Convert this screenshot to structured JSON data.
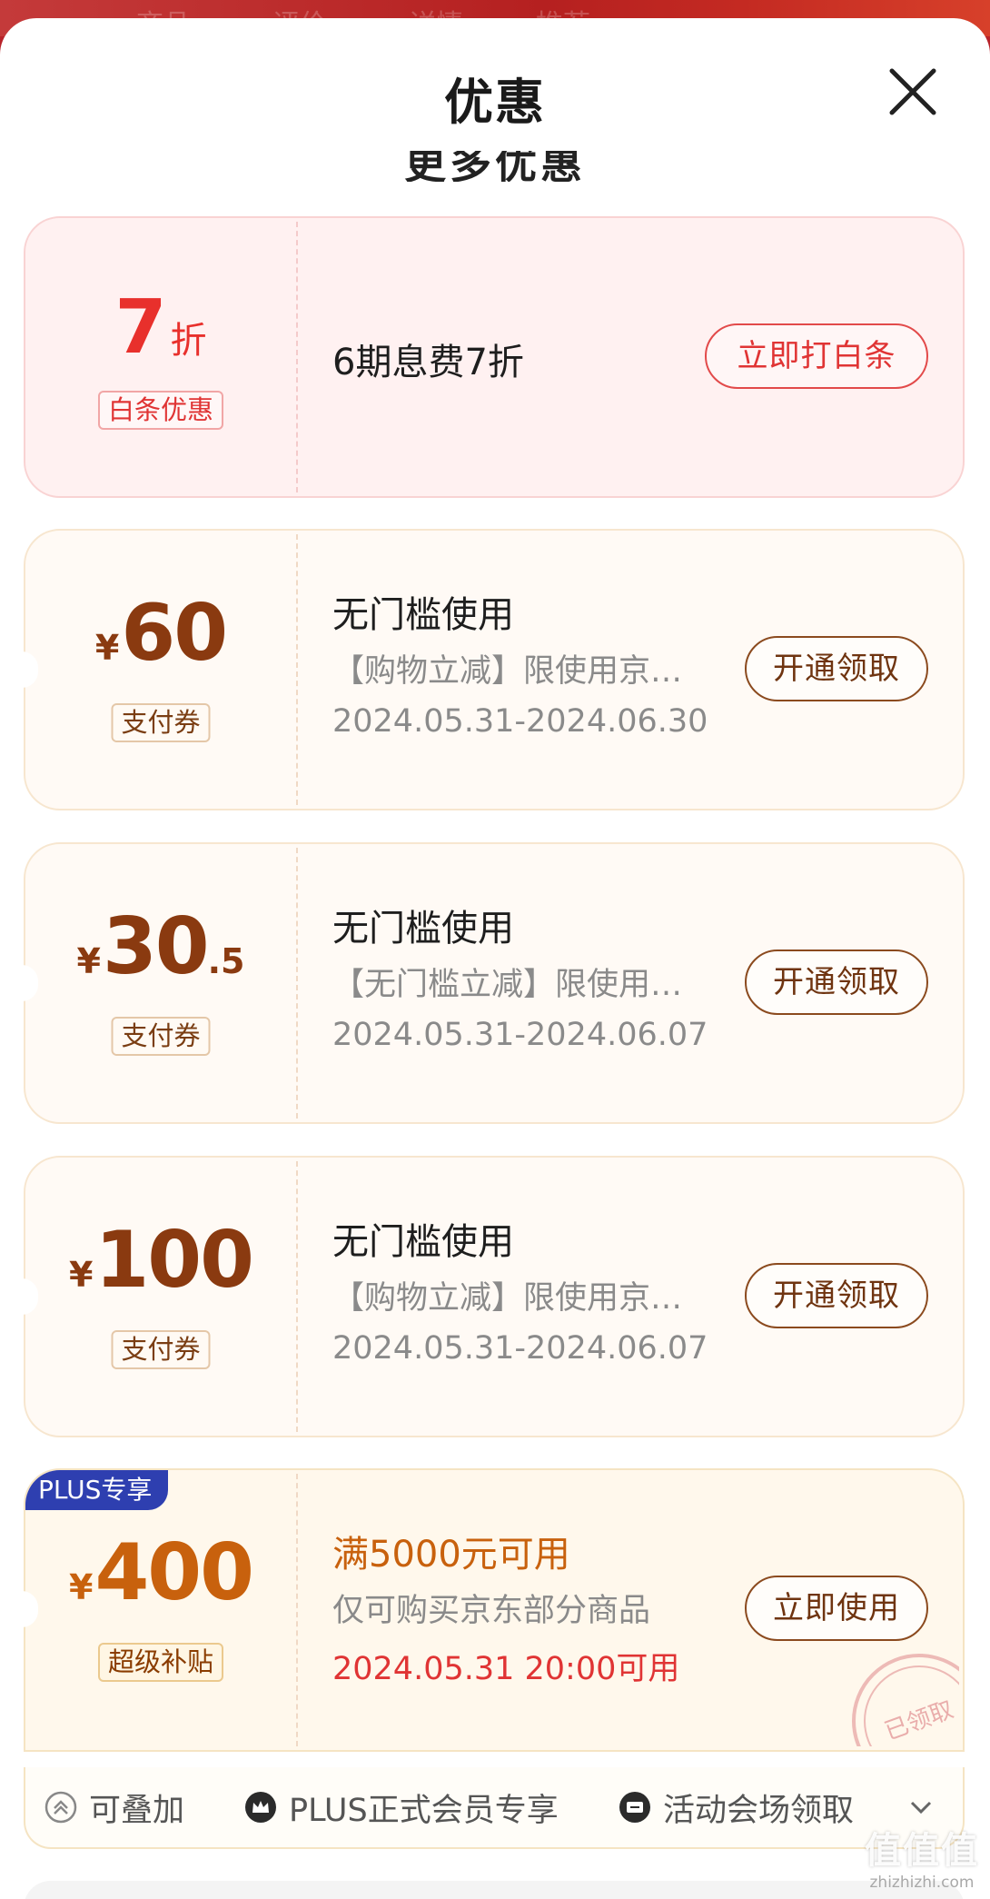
{
  "header": {
    "title": "优惠",
    "close_icon": "close-icon",
    "section_title": "更多优惠"
  },
  "background_tabs": [
    "商品",
    "评价",
    "详情",
    "推荐"
  ],
  "coupons": [
    {
      "type": "baitiao",
      "discount": "7",
      "discount_unit": "折",
      "badge": "白条优惠",
      "title": "6期息费7折",
      "button": "立即打白条"
    },
    {
      "type": "pay",
      "currency": "¥",
      "amount": "60",
      "amount_decimal": "",
      "badge": "支付券",
      "title": "无门槛使用",
      "desc": "【购物立减】限使用京…",
      "validity": "2024.05.31-2024.06.30",
      "button": "开通领取"
    },
    {
      "type": "pay",
      "currency": "¥",
      "amount": "30",
      "amount_decimal": ".5",
      "badge": "支付券",
      "title": "无门槛使用",
      "desc": "【无门槛立减】限使用…",
      "validity": "2024.05.31-2024.06.07",
      "button": "开通领取"
    },
    {
      "type": "pay",
      "currency": "¥",
      "amount": "100",
      "amount_decimal": "",
      "badge": "支付券",
      "title": "无门槛使用",
      "desc": "【购物立减】限使用京…",
      "validity": "2024.05.31-2024.06.07",
      "button": "开通领取"
    },
    {
      "type": "plus",
      "tag": "PLUS专享",
      "currency": "¥",
      "amount": "400",
      "amount_decimal": "",
      "badge": "超级补贴",
      "title": "满5000元可用",
      "desc": "仅可购买京东部分商品",
      "validity": "2024.05.31 20:00可用",
      "button": "立即使用",
      "stamp": "已领取"
    }
  ],
  "footer": {
    "features": [
      "可叠加",
      "PLUS正式会员专享",
      "活动会场领取"
    ],
    "icons": [
      "stack-icon",
      "crown-icon",
      "ticket-icon",
      "chevron-down-icon"
    ]
  },
  "watermark": {
    "big": "值值值",
    "small": "zhizhizhi.com"
  },
  "colors": {
    "accent_red": "#e03434",
    "coupon_brown": "#8a3a10",
    "plus_orange": "#c8610d",
    "plus_blue": "#2e3fb0"
  }
}
